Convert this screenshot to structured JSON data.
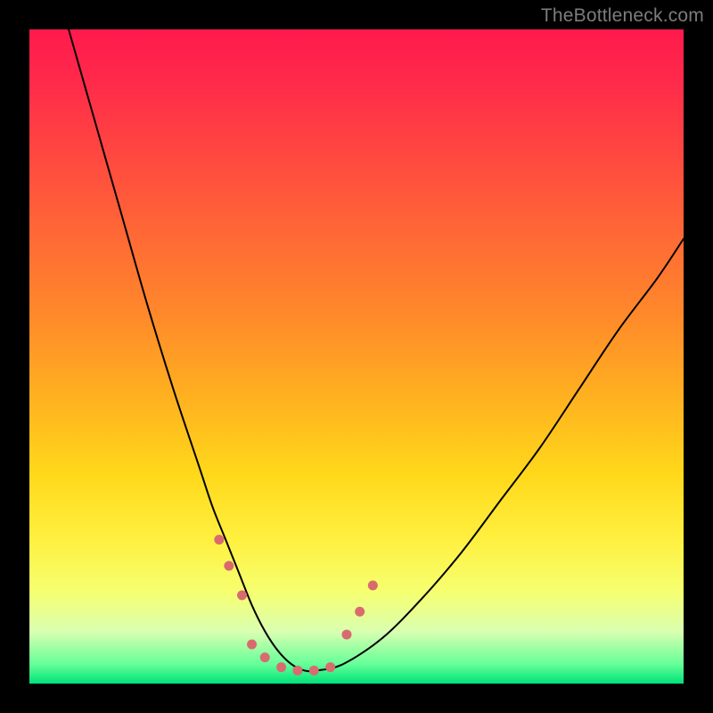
{
  "watermark": "TheBottleneck.com",
  "chart_data": {
    "type": "line",
    "title": "",
    "xlabel": "",
    "ylabel": "",
    "xlim": [
      0,
      100
    ],
    "ylim": [
      0,
      100
    ],
    "grid": false,
    "legend": false,
    "background_gradient": {
      "direction": "vertical",
      "stops": [
        {
          "pos": 0.0,
          "color": "#ff1a4d"
        },
        {
          "pos": 0.2,
          "color": "#ff4a3f"
        },
        {
          "pos": 0.44,
          "color": "#ff8a2a"
        },
        {
          "pos": 0.68,
          "color": "#ffd81a"
        },
        {
          "pos": 0.86,
          "color": "#f6ff70"
        },
        {
          "pos": 0.97,
          "color": "#66ff99"
        },
        {
          "pos": 1.0,
          "color": "#00e27a"
        }
      ]
    },
    "series": [
      {
        "name": "bottleneck-curve",
        "x": [
          6,
          10,
          14,
          18,
          22,
          26,
          28,
          30,
          32,
          34,
          36,
          38,
          40,
          42,
          44,
          48,
          54,
          60,
          66,
          72,
          78,
          84,
          90,
          96,
          100
        ],
        "y": [
          100,
          86,
          72,
          58,
          45,
          33,
          27,
          22,
          17,
          12,
          8,
          5,
          3,
          2,
          2,
          3,
          7,
          13,
          20,
          28,
          36,
          45,
          54,
          62,
          68
        ]
      }
    ],
    "marker_segments": [
      {
        "name": "dotted-left",
        "color": "#d96b6f",
        "width": 11,
        "x": [
          29.0,
          30.5,
          32.5
        ],
        "y": [
          22.0,
          18.0,
          13.5
        ]
      },
      {
        "name": "dotted-bottom",
        "color": "#d96b6f",
        "width": 11,
        "x": [
          34.0,
          36.0,
          38.5,
          41.0,
          43.5,
          46.0
        ],
        "y": [
          6.0,
          4.0,
          2.5,
          2.0,
          2.0,
          2.5
        ]
      },
      {
        "name": "dotted-right",
        "color": "#d96b6f",
        "width": 11,
        "x": [
          48.5,
          50.5,
          52.5
        ],
        "y": [
          7.5,
          11.0,
          15.0
        ]
      }
    ]
  }
}
